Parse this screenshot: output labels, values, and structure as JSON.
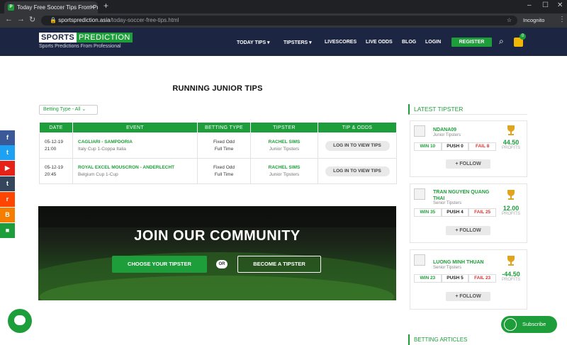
{
  "browser": {
    "tab_title": "Today Free Soccer Tips From Pro",
    "tab_favicon": "P",
    "new_tab": "+",
    "url_domain": "sportsprediction.asia",
    "url_path": "/today-soccer-free-tips.html",
    "incognito": "Incognito"
  },
  "header": {
    "logo_part1": "SPORTS",
    "logo_part2": "PREDICTION",
    "logo_tagline": "Sports Predictions From Professional",
    "nav": [
      {
        "label": "TODAY TIPS ▾"
      },
      {
        "label": "TIPSTERS ▾"
      },
      {
        "label": "LIVESCORES"
      },
      {
        "label": "LIVE ODDS"
      },
      {
        "label": "BLOG"
      },
      {
        "label": "LOGIN"
      }
    ],
    "register": "REGISTER",
    "cart_count": "0",
    "brand_color": "#1e9e3a",
    "header_bg": "#1c2541"
  },
  "main": {
    "title": "RUNNING JUNIOR TIPS",
    "filter": "Betting Type - All ⌄",
    "table": {
      "headers": [
        "DATE",
        "EVENT",
        "BETTING TYPE",
        "TIPSTER",
        "TIP & ODDS"
      ],
      "rows": [
        {
          "date": "05-12-19",
          "time": "21:00",
          "event": "CAGLIARI - SAMPDORIA",
          "league": "Italy Cup 1-Coppa Italia",
          "bet_type": "Fixed Odd",
          "bet_period": "Full Time",
          "tipster": "RACHEL SIMS",
          "tipster_rank": "Junior Tipsters",
          "action": "LOG IN TO VIEW TIPS"
        },
        {
          "date": "05-12-19",
          "time": "20:45",
          "event": "ROYAL EXCEL MOUSCRON - ANDERLECHT",
          "league": "Belgium Cup 1-Cup",
          "bet_type": "Fixed Odd",
          "bet_period": "Full Time",
          "tipster": "RACHEL SIMS",
          "tipster_rank": "Junior Tipsters",
          "action": "LOG IN TO VIEW TIPS"
        }
      ]
    },
    "banner": {
      "title": "JOIN OUR COMMUNITY",
      "choose": "CHOOSE YOUR TIPSTER",
      "or": "OR",
      "become": "BECOME A TIPSTER"
    }
  },
  "sidebar": {
    "title": "LATEST TIPSTER",
    "tipsters": [
      {
        "name": "NDANA09",
        "rank": "Junior Tipsters",
        "win": "WIN 10",
        "push": "PUSH 0",
        "fail": "FAIL 8",
        "profit": "44.50",
        "profit_label": "PROFITS",
        "follow": "+ FOLLOW"
      },
      {
        "name": "TRAN NGUYEN QUANG THAI",
        "rank": "Senior Tipsters",
        "win": "WIN 35",
        "push": "PUSH 4",
        "fail": "FAIL 25",
        "profit": "12.00",
        "profit_label": "PROFITS",
        "follow": "+ FOLLOW"
      },
      {
        "name": "LUONG MINH THUAN",
        "rank": "Senior Tipsters",
        "win": "WIN 23",
        "push": "PUSH 5",
        "fail": "FAIL 23",
        "profit": "-44.50",
        "profit_label": "PROFITS",
        "follow": "+ FOLLOW"
      }
    ],
    "section2": "BETTING ARTICLES"
  },
  "share": [
    {
      "icon": "facebook-icon",
      "glyph": "f",
      "color": "#3b5998"
    },
    {
      "icon": "twitter-icon",
      "glyph": "t",
      "color": "#1da1f2"
    },
    {
      "icon": "youtube-icon",
      "glyph": "▶",
      "color": "#e62117"
    },
    {
      "icon": "tumblr-icon",
      "glyph": "t",
      "color": "#35465c"
    },
    {
      "icon": "reddit-icon",
      "glyph": "r",
      "color": "#ff4500"
    },
    {
      "icon": "blogger-icon",
      "glyph": "B",
      "color": "#f57d00"
    },
    {
      "icon": "video-icon",
      "glyph": "■",
      "color": "#1e9e3a"
    }
  ],
  "subscribe": "Subscribe"
}
